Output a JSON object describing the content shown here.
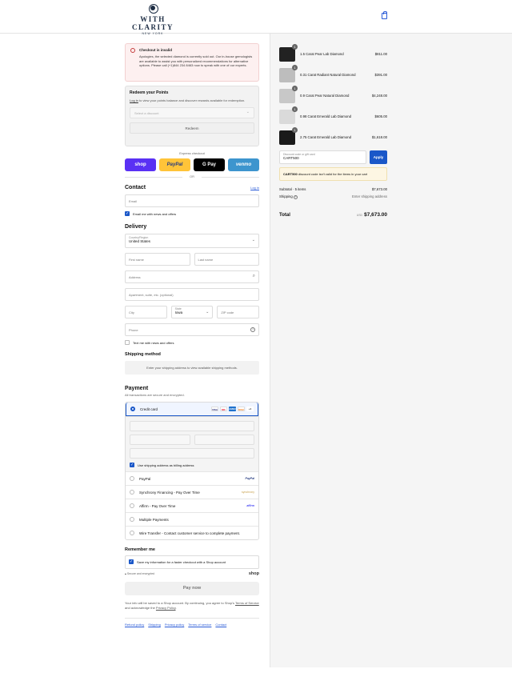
{
  "brand": {
    "name": "WITH CLARITY",
    "location": "NEW YORK"
  },
  "alert": {
    "title": "Checkout is invalid",
    "body": "Apologies, the selected diamond is currently sold out. Our in-house gemologists are available to assist you with personalized recommendations for alternative options. Please call (+1)844 234 8463 now to speak with one of our experts."
  },
  "points": {
    "title": "Redeem your Points",
    "login_link": "Log in",
    "text": " to view your points balance and discover rewards available for redemption.",
    "select_placeholder": "Select a discount",
    "redeem_label": "Redeem"
  },
  "express": {
    "label": "Express checkout",
    "buttons": [
      "shop",
      "PayPal",
      "G Pay",
      "venmo"
    ],
    "or": "OR"
  },
  "contact": {
    "title": "Contact",
    "login": "Log in",
    "email_placeholder": "Email",
    "news_label": "Email me with news and offers"
  },
  "delivery": {
    "title": "Delivery",
    "country_label": "Country/Region",
    "country_value": "United States",
    "first_name": "First name",
    "last_name": "Last name",
    "address": "Address",
    "apartment": "Apartment, suite, etc. (optional)",
    "city": "City",
    "state_label": "State",
    "state_value": "Iowa",
    "zip": "ZIP code",
    "phone": "Phone",
    "text_label": "Text me with news and offers"
  },
  "shipping_method": {
    "title": "Shipping method",
    "message": "Enter your shipping address to view available shipping methods."
  },
  "payment": {
    "title": "Payment",
    "subtitle": "All transactions are secure and encrypted.",
    "credit_card": "Credit card",
    "card_brands": [
      "VISA",
      "MC",
      "AMEX",
      "DISC",
      "+4"
    ],
    "billing_label": "Use shipping address as billing address",
    "options": [
      {
        "label": "PayPal",
        "brand": "PayPal"
      },
      {
        "label": "Synchrony Financing - Pay Over Time",
        "brand": "synchrony"
      },
      {
        "label": "Affirm - Pay Over Time",
        "brand": "affirm"
      },
      {
        "label": "Multiple Payments",
        "brand": ""
      },
      {
        "label": "Wire Transfer - Contact customer service to complete payment.",
        "brand": ""
      }
    ]
  },
  "remember": {
    "title": "Remember me",
    "save_label": "Save my information for a faster checkout with a Shop account",
    "secure": "Secure and encrypted",
    "shop": "shop"
  },
  "pay_now": "Pay now",
  "legal": {
    "text": "Your info will be saved to a Shop account. By continuing, you agree to Shop's ",
    "tos": "Terms of Service",
    "and": " and acknowledge the ",
    "privacy": "Privacy Policy",
    "end": "."
  },
  "footer_links": [
    "Refund policy",
    "Shipping",
    "Privacy policy",
    "Terms of service",
    "Contact"
  ],
  "cart": {
    "items": [
      {
        "name": "1.5 Carat Pear Lab Diamond",
        "price": "$811.00",
        "qty": "1",
        "thumb": "#222"
      },
      {
        "name": "0.31 Carat Radiant Natural Diamond",
        "price": "$391.00",
        "qty": "1",
        "thumb": "#bdbdbd"
      },
      {
        "name": "0.9 Carat Pear Natural Diamond",
        "price": "$4,248.00",
        "qty": "1",
        "thumb": "#c8c8c8"
      },
      {
        "name": "0.98 Carat Emerald Lab Diamond",
        "price": "$605.00",
        "qty": "1",
        "thumb": "#dadada"
      },
      {
        "name": "2.75 Carat Emerald Lab Diamond",
        "price": "$1,618.00",
        "qty": "1",
        "thumb": "#1a1a1a"
      }
    ],
    "discount_label": "Discount code or gift card",
    "discount_value": "CART500",
    "apply": "Apply",
    "warn_code": "CART500",
    "warn_text": " discount code isn't valid for the items in your cart",
    "subtotal_label": "Subtotal · 5 items",
    "subtotal": "$7,673.00",
    "shipping_label": "Shipping",
    "shipping_value": "Enter shipping address",
    "total_label": "Total",
    "currency": "USD",
    "total": "$7,673.00"
  },
  "colors": {
    "accent": "#1a57c8",
    "brand": "#1d2d44",
    "shop": "#5a31f4",
    "paypal": "#ffc439",
    "venmo": "#3d95ce"
  }
}
